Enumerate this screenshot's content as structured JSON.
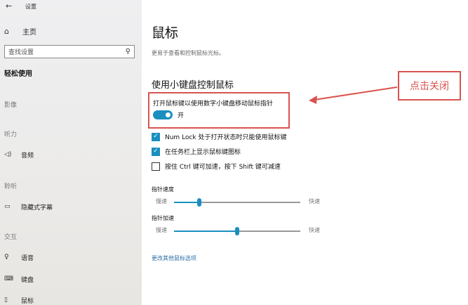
{
  "window": {
    "title": "设置"
  },
  "sidebar": {
    "home_label": "主页",
    "search_placeholder": "查找设置",
    "group_title": "轻松使用",
    "categories": [
      "影像",
      "听力",
      "聆听",
      "交互"
    ],
    "items": [
      {
        "label": "音频",
        "icon": "speaker-icon"
      },
      {
        "label": "隐藏式字幕",
        "icon": "caption-icon"
      },
      {
        "label": "语音",
        "icon": "mic-icon"
      },
      {
        "label": "键盘",
        "icon": "keyboard-icon"
      },
      {
        "label": "鼠标",
        "icon": "mouse-icon"
      }
    ]
  },
  "main": {
    "title": "鼠标",
    "subtitle": "更易于查看和控制鼠标光标。",
    "section_title": "使用小键盘控制鼠标",
    "toggle": {
      "label": "打开鼠标键以使用数字小键盘移动鼠标指针",
      "state_text": "开",
      "on": true
    },
    "checkboxes": [
      {
        "label": "Num Lock 处于打开状态时只能使用鼠标键",
        "checked": true
      },
      {
        "label": "在任务栏上显示鼠标键图标",
        "checked": true
      },
      {
        "label": "按住 Ctrl 键可加速，按下 Shift 键可减速",
        "checked": false
      }
    ],
    "sliders": [
      {
        "label": "指针速度",
        "min_label": "慢速",
        "max_label": "快速",
        "value": 0.2
      },
      {
        "label": "指针加速",
        "min_label": "慢速",
        "max_label": "快速",
        "value": 0.5
      }
    ],
    "link": "更改其他鼠标选项"
  },
  "annotation": {
    "text": "点击关闭",
    "color": "#d9534f"
  },
  "colors": {
    "accent": "#1a8fbf"
  }
}
